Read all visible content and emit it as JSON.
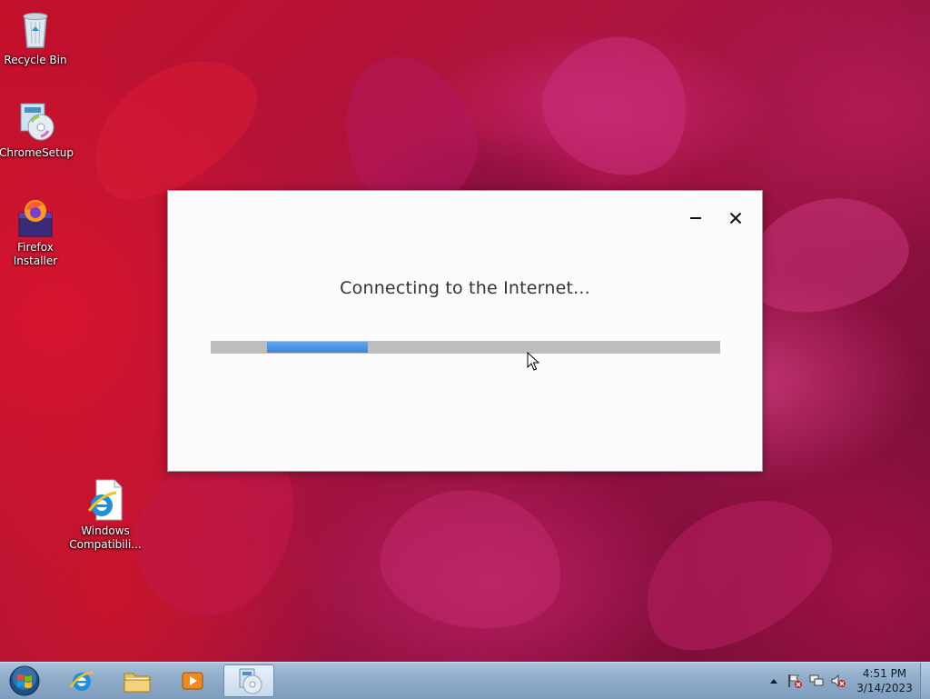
{
  "desktop": {
    "icons": [
      {
        "label": "Recycle Bin",
        "icon": "recycle-bin-icon"
      },
      {
        "label": "ChromeSetup",
        "icon": "installer-disc-icon"
      },
      {
        "label": "Firefox Installer",
        "icon": "firefox-installer-icon"
      },
      {
        "label": "Windows Compatibili...",
        "icon": "internet-explorer-document-icon"
      }
    ]
  },
  "dialog": {
    "status_text": "Connecting to the Internet...",
    "progress": {
      "state": "indeterminate"
    },
    "minimize_icon": "minimize-icon",
    "close_icon": "close-icon"
  },
  "taskbar": {
    "start_icon": "windows-start-orb",
    "pinned": [
      {
        "name": "internet-explorer",
        "icon": "internet-explorer-icon"
      },
      {
        "name": "file-explorer",
        "icon": "folder-icon"
      },
      {
        "name": "media-player",
        "icon": "media-player-icon"
      },
      {
        "name": "setup",
        "icon": "installer-disc-icon",
        "active": true
      }
    ],
    "tray": {
      "icons": [
        "show-hidden-icons-arrow",
        "action-center-flag-icon",
        "network-icon",
        "volume-muted-icon"
      ]
    },
    "clock": {
      "time": "4:51 PM",
      "date": "3/14/2023"
    }
  },
  "colors": {
    "progress_fill": "#3c86d9",
    "progress_track": "#bdbdbd",
    "dialog_bg": "#fcfcfc",
    "taskbar": "#8eabc8"
  }
}
